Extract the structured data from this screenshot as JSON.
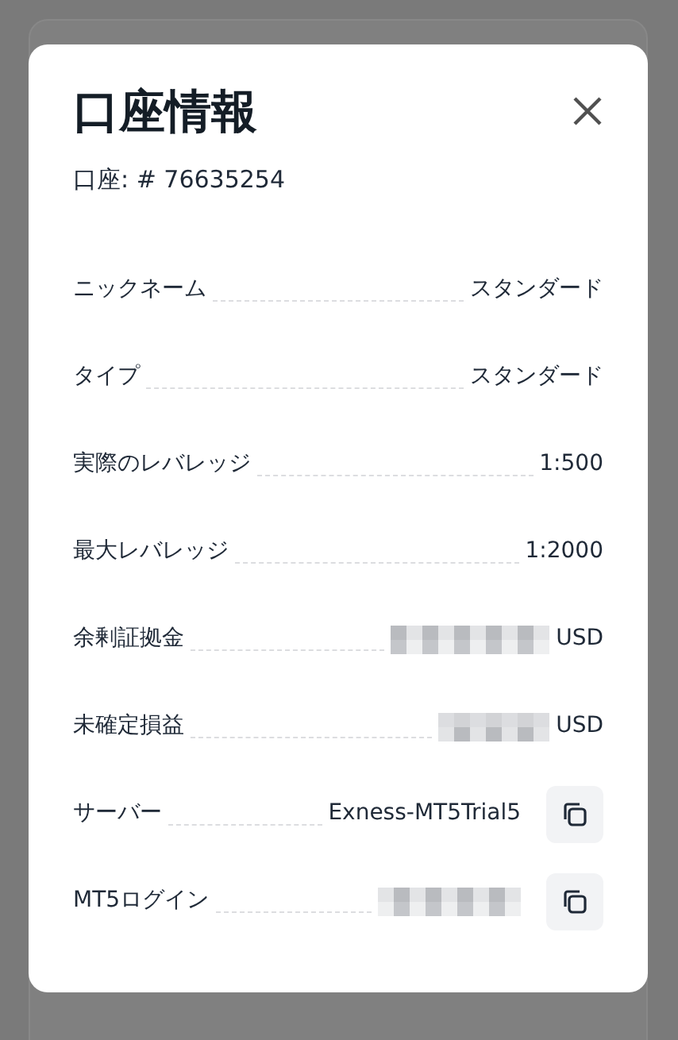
{
  "dialog": {
    "title": "口座情報",
    "account": "口座: # 76635254",
    "rows": [
      {
        "label": "ニックネーム",
        "value": "スタンダード",
        "masked": false,
        "copyable": false
      },
      {
        "label": "タイプ",
        "value": "スタンダード",
        "masked": false,
        "copyable": false
      },
      {
        "label": "実際のレバレッジ",
        "value": "1:500",
        "masked": false,
        "copyable": false
      },
      {
        "label": "最大レバレッジ",
        "value": "1:2000",
        "masked": false,
        "copyable": false
      },
      {
        "label": "余剰証拠金",
        "unit": "USD",
        "masked": true,
        "copyable": false
      },
      {
        "label": "未確定損益",
        "unit": "USD",
        "masked": true,
        "copyable": false
      },
      {
        "label": "サーバー",
        "value": "Exness-MT5Trial5",
        "masked": false,
        "copyable": true
      },
      {
        "label": "MT5ログイン",
        "masked": true,
        "copyable": true
      }
    ]
  }
}
